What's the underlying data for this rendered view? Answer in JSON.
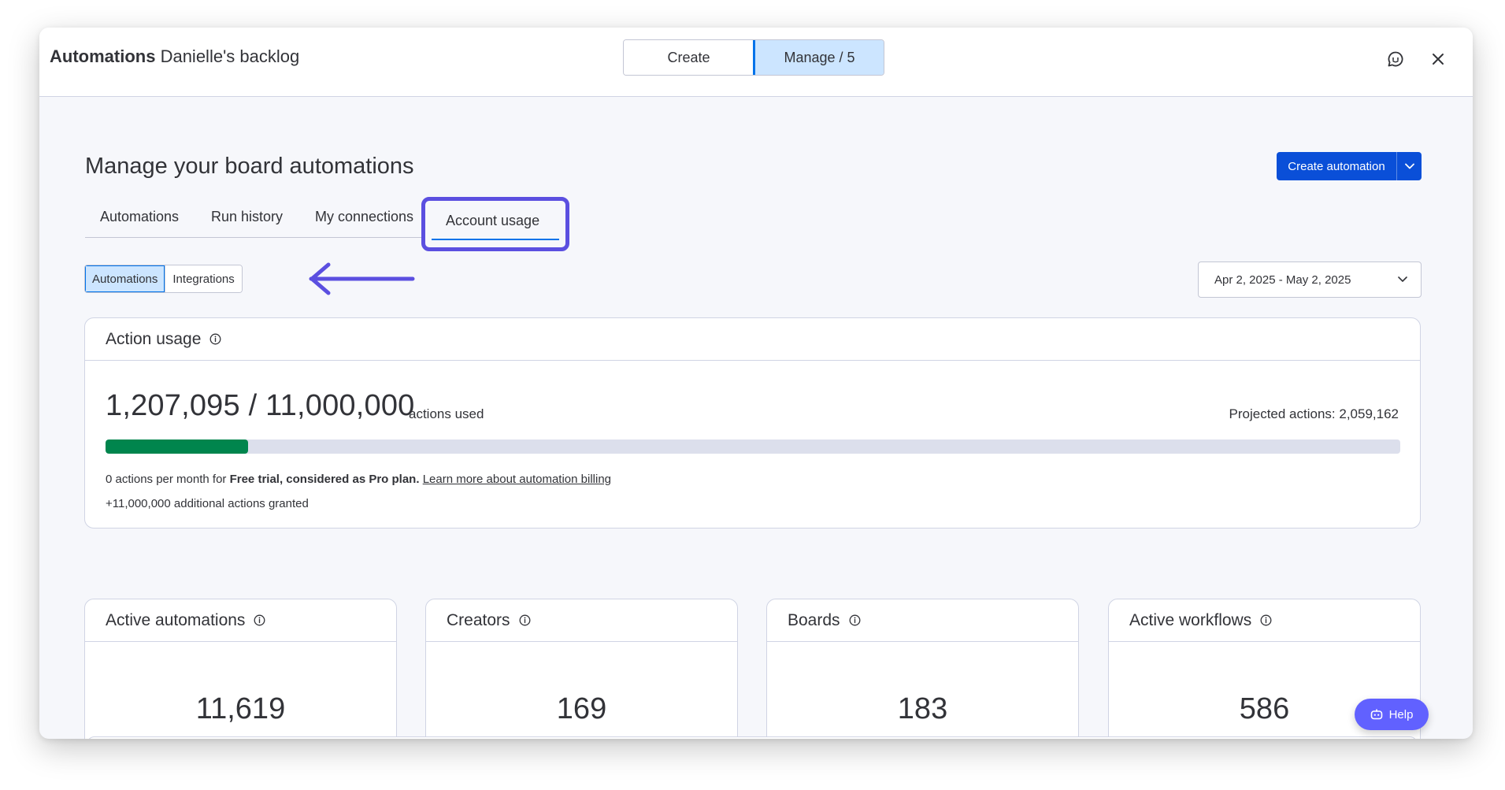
{
  "header": {
    "app_name": "Automations",
    "board_name": "Danielle's backlog",
    "mode_tabs": [
      {
        "label": "Create",
        "active": false
      },
      {
        "label": "Manage / 5",
        "active": true
      }
    ],
    "icons": [
      "chat-icon",
      "close-icon"
    ]
  },
  "page": {
    "title": "Manage your board automations",
    "create_button_label": "Create automation",
    "tabs": [
      {
        "label": "Automations",
        "active": false
      },
      {
        "label": "Run history",
        "active": false
      },
      {
        "label": "My connections",
        "active": false
      },
      {
        "label": "Account usage",
        "active": true
      }
    ],
    "segment": [
      {
        "label": "Automations",
        "active": true
      },
      {
        "label": "Integrations",
        "active": false
      }
    ],
    "date_range": "Apr 2, 2025 - May 2, 2025",
    "accent_color": "#5b4fe0"
  },
  "usage": {
    "title": "Action usage",
    "used_total": "1,207,095 / 11,000,000",
    "unit": "actions used",
    "projected": "Projected actions: 2,059,162",
    "progress_fraction": 0.11,
    "billing_prefix": "0 actions per month for ",
    "billing_plan": "Free trial, considered as Pro plan.",
    "billing_link": "Learn more about automation billing",
    "granted": "+11,000,000 additional actions granted"
  },
  "stats": [
    {
      "title": "Active automations",
      "value": "11,619"
    },
    {
      "title": "Creators",
      "value": "169"
    },
    {
      "title": "Boards",
      "value": "183"
    },
    {
      "title": "Active workflows",
      "value": "586"
    }
  ],
  "help_label": "Help"
}
